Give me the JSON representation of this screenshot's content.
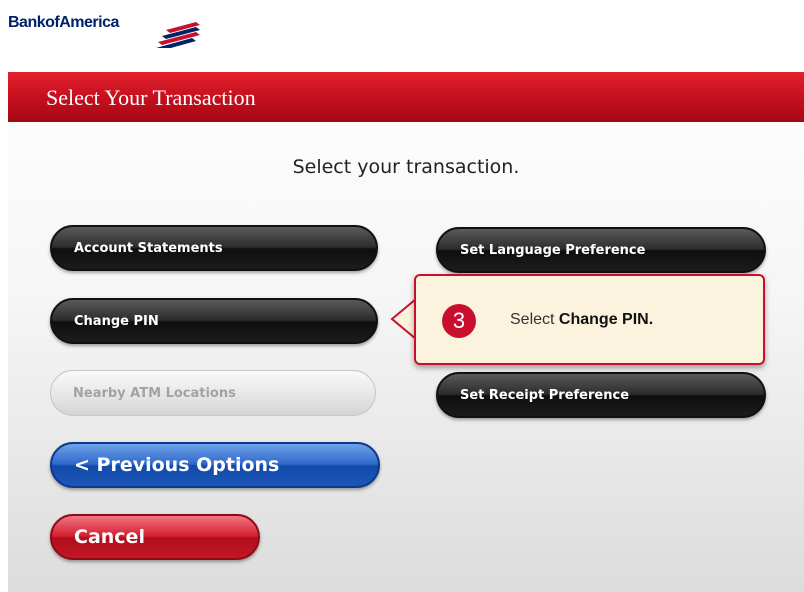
{
  "brand": {
    "name": "Bank of America",
    "logo_text": "BankofAmerica",
    "colors": {
      "navy": "#012169",
      "red": "#c8102e"
    }
  },
  "header": {
    "title": "Select Your Transaction"
  },
  "prompt": "Select your transaction.",
  "buttons": {
    "account_statements": "Account Statements",
    "change_pin": "Change PIN",
    "nearby_atm": "Nearby ATM Locations",
    "previous_options": "< Previous Options",
    "cancel": "Cancel",
    "set_language": "Set Language Preference",
    "set_receipt": "Set Receipt Preference"
  },
  "callout": {
    "step_number": "3",
    "text_prefix": "Select ",
    "text_emphasis": "Change PIN."
  },
  "icons": {
    "logo_flag": "flag-icon"
  }
}
